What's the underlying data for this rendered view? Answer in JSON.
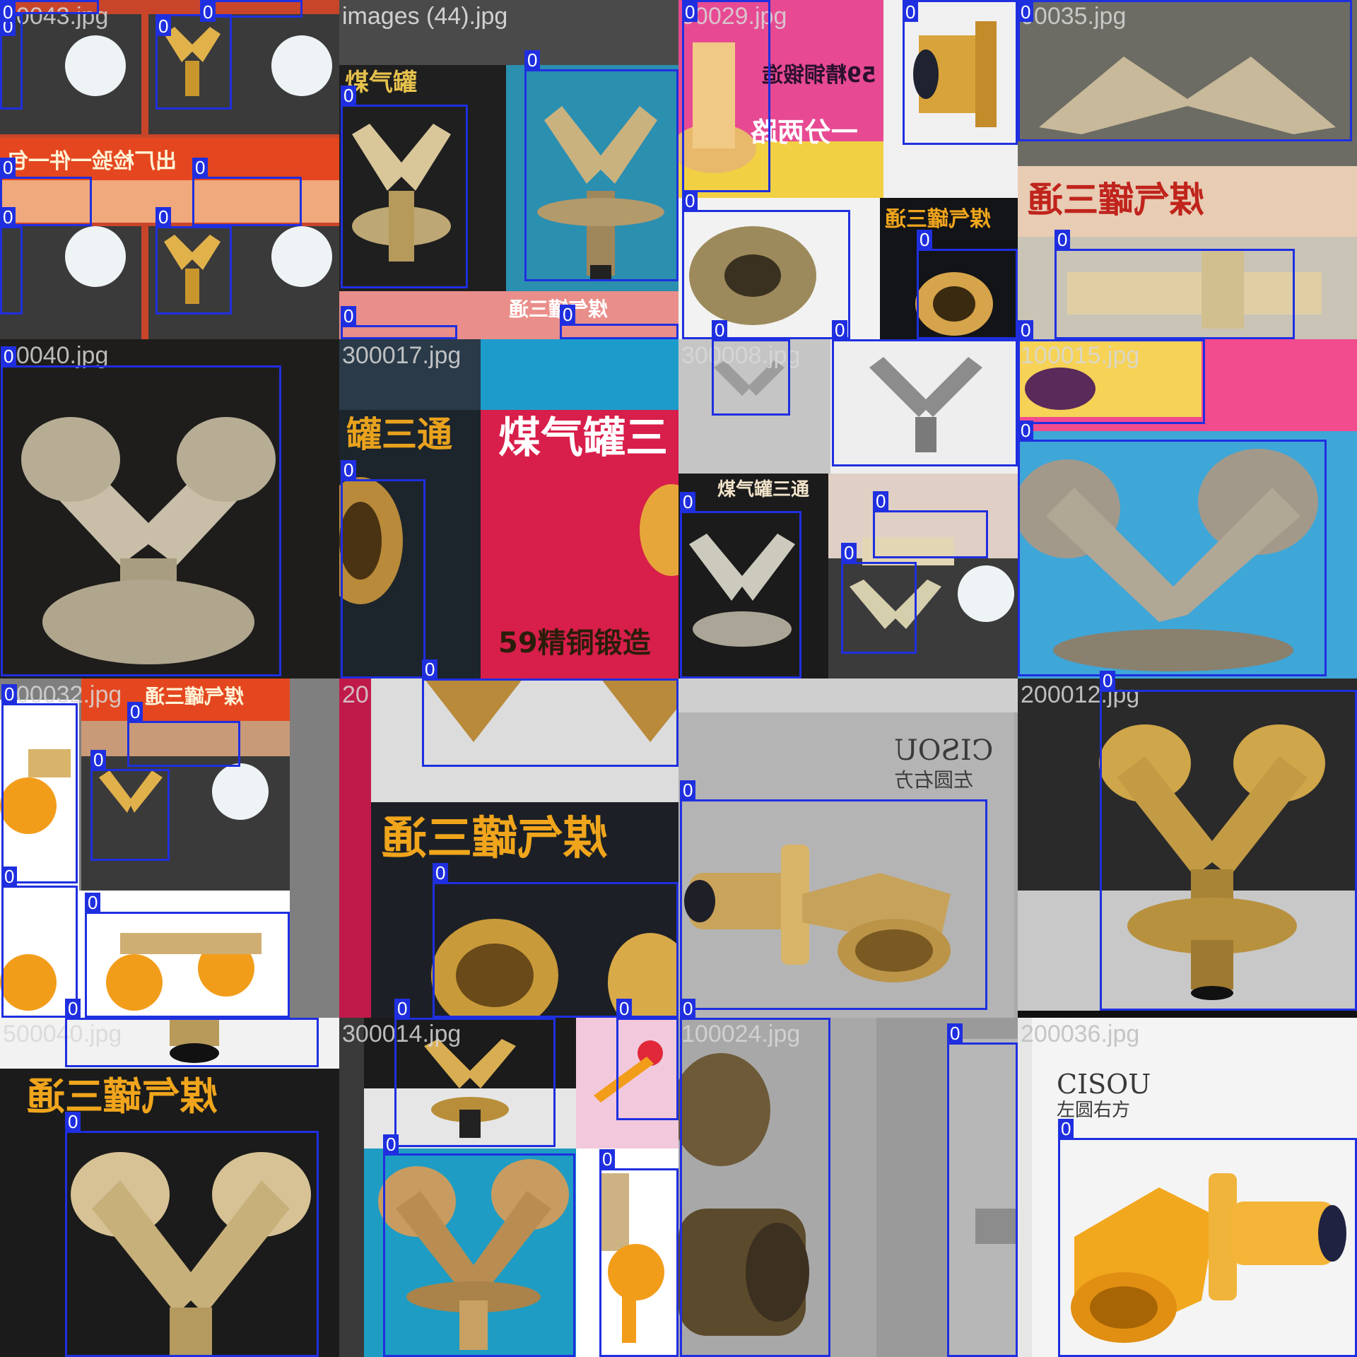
{
  "mosaic": {
    "tiles": [
      {
        "name": "00043.jpg",
        "bg": "#c94a2a"
      },
      {
        "name": "images (44).jpg",
        "bg": "#4a4a4a"
      },
      {
        "name": "00029.jpg",
        "bg": "#e23c8a"
      },
      {
        "name": "00035.jpg",
        "bg": "#6e6e66"
      },
      {
        "name": "00040.jpg",
        "bg": "#1e1d1b"
      },
      {
        "name": "300017.jpg",
        "bg": "#2a3a48"
      },
      {
        "name": "300008.jpg",
        "bg": "#b9b9b9"
      },
      {
        "name": "100015.jpg",
        "bg": "#4aa4d6"
      },
      {
        "name": "100032.jpg",
        "bg": "#7f7f7f"
      },
      {
        "name": "20",
        "bg": "#d8d8d8"
      },
      {
        "name": "",
        "bg": "#a9a9a9"
      },
      {
        "name": "200012.jpg",
        "bg": "#1f1f1f"
      },
      {
        "name": "500040.jpg",
        "bg": "#1b1b1b"
      },
      {
        "name": "300014.jpg",
        "bg": "#2aa2c4"
      },
      {
        "name": "100024.jpg",
        "bg": "#9c9c9c"
      },
      {
        "name": "200036.jpg",
        "bg": "#f4f4f4"
      }
    ],
    "box_label": "0",
    "box_color": "#1f2fe0",
    "banner_texts": {
      "tile1_top": "煤气罐",
      "tile2_mid": "59精铜锻造",
      "tile2_low": "一分两路",
      "tile3_mid": "煤气罐三通",
      "tile5_big": "煤气罐三",
      "tile5_side": "罐三通",
      "tile5_bottom": "59精铜锻造",
      "tile6_strip": "煤气罐三通",
      "tile9_big": "煤气罐三通",
      "tile12_big": "煤气罐三通",
      "tile0_stamp": "出厂检验一件一包",
      "tile2_stamp": "煤气罐三通"
    },
    "logos": {
      "tile10_brand": "CISOU",
      "tile10_sub": "左圆右方",
      "tile15_brand": "CISOU",
      "tile15_sub": "左圆右方"
    }
  }
}
